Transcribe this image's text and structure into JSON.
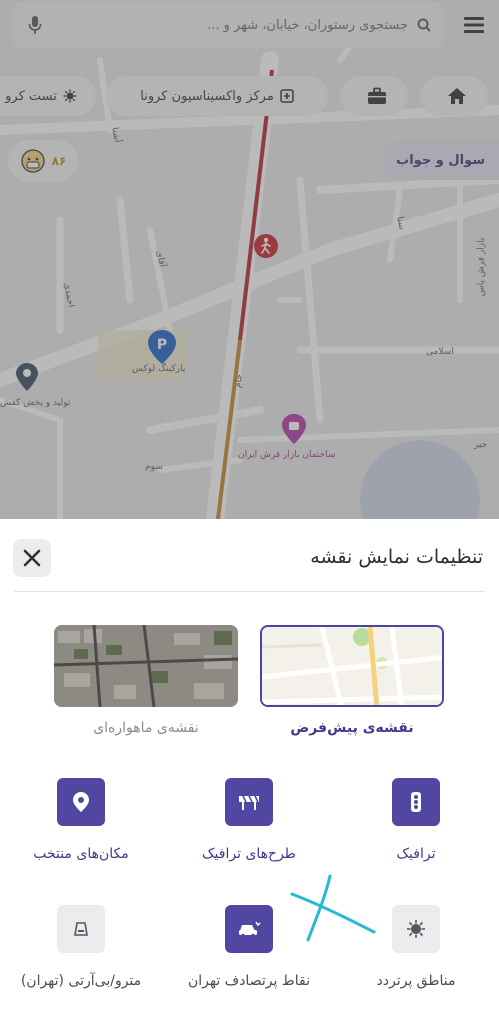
{
  "search": {
    "placeholder": "جستجوی رستوران، خیابان، شهر و ..."
  },
  "chips": {
    "home_label": "",
    "work_label": "",
    "vaccination_label": "مرکز واکسیناسیون کرونا",
    "covid_test_label": "تست کرو"
  },
  "qa_label": "سوال و جواب",
  "aqi_value": "۸۶",
  "map_labels": {
    "parking": "پارکینگ لوکس",
    "rug_bazaar": "ساختمان بازار فرش ایران",
    "production": "تولید و پخش کفش",
    "eslami": "اسلامی",
    "som": "سوم",
    "jam": "جام",
    "alley1": "آقای",
    "alley2": "آشنا",
    "alley3": "احمدی",
    "street_right": "بازار فرش پاس",
    "street_right2": "سنا",
    "jir": "جیر"
  },
  "sheet": {
    "title": "تنظیمات نمایش نقشه",
    "map_types": [
      {
        "label": "نقشه‌ی پیش‌فرض",
        "selected": true
      },
      {
        "label": "نقشه‌ی ماهواره‌ای",
        "selected": false
      }
    ],
    "layers": [
      {
        "label": "ترافیک",
        "icon": "traffic-light-icon",
        "active": true
      },
      {
        "label": "طرح‌های ترافیک",
        "icon": "barrier-icon",
        "active": true
      },
      {
        "label": "مکان‌های منتخب",
        "icon": "map-pin-icon",
        "active": true
      },
      {
        "label": "مناطق پرتردد",
        "icon": "virus-icon",
        "active": false
      },
      {
        "label": "نقاط پرتصادف تهران",
        "icon": "car-crash-icon",
        "active": true
      },
      {
        "label": "مترو/بی‌آرتی (تهران)",
        "icon": "metro-icon",
        "active": false
      }
    ]
  },
  "colors": {
    "accent": "#5246a3",
    "accent_text": "#3f3a8c",
    "traffic_red": "#b3282d",
    "scribble": "#2ab7d8"
  }
}
